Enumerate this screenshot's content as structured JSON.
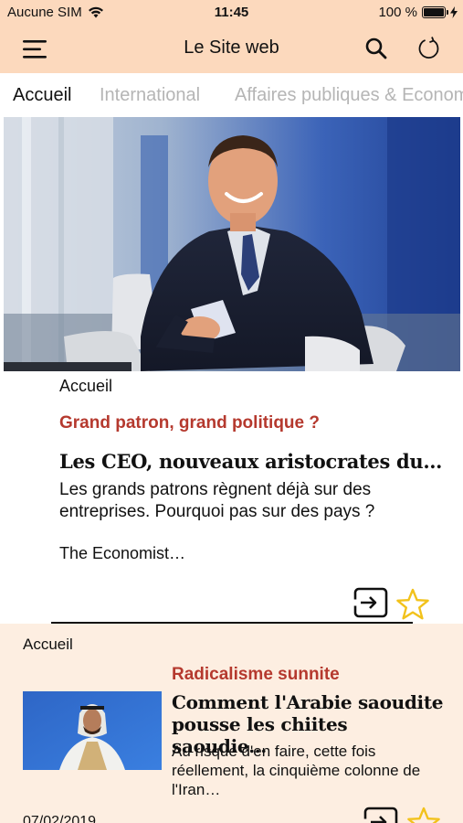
{
  "status_bar": {
    "carrier": "Aucune SIM",
    "time": "11:45",
    "battery_percent": "100 %",
    "battery_level": 1.0
  },
  "nav": {
    "title": "Le Site web",
    "menu_icon": "hamburger-menu-icon",
    "search_icon": "search-icon",
    "refresh_icon": "refresh-icon"
  },
  "tabs": [
    {
      "label": "Accueil",
      "active": true
    },
    {
      "label": "International",
      "active": false
    },
    {
      "label": "Affaires publiques & Economie",
      "active": false
    }
  ],
  "article1": {
    "section": "Accueil",
    "kicker": "Grand patron, grand politique ?",
    "title": "Les CEO, nouveaux aristocrates du…",
    "lede": "Les grands patrons règnent déjà sur des entreprises. Pourquoi pas sur des pays ?",
    "source": "The Economist…"
  },
  "article2": {
    "section": "Accueil",
    "kicker": "Radicalisme sunnite",
    "title": "Comment l'Arabie saoudite pousse les chiites saoudie…",
    "lede": "Au risque d'en faire, cette fois réellement, la cinquième colonne de l'Iran…",
    "date": "07/02/2019"
  },
  "colors": {
    "header_bg": "#fcd9bd",
    "card_bg": "#fdeee1",
    "kicker": "#b5392e",
    "star": "#f2c21b",
    "tab_inactive": "#b5b5b5"
  }
}
